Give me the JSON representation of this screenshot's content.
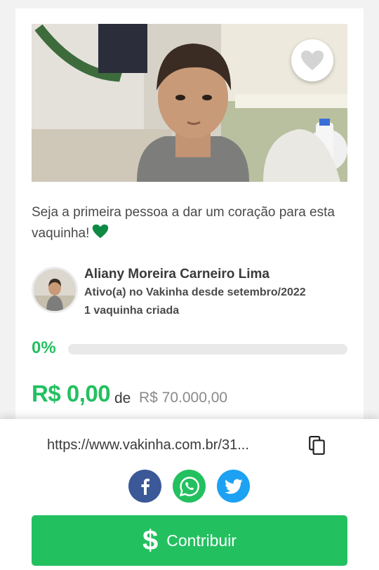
{
  "campaign": {
    "image_alt": "Foto da vaquinha: menino de camiseta cinza",
    "first_heart_text": "Seja a primeira pessoa a dar um coração para esta vaquinha!"
  },
  "creator": {
    "name": "Aliany Moreira Carneiro Lima",
    "since": "Ativo(a) no Vakinha desde setembro/2022",
    "count": "1 vaquinha criada"
  },
  "progress": {
    "percent_label": "0%",
    "fraction": 0
  },
  "amounts": {
    "raised": "R$ 0,00",
    "of": "de",
    "goal": "R$ 70.000,00"
  },
  "share": {
    "link": "https://www.vakinha.com.br/31...",
    "facebook_icon": "facebook-icon",
    "whatsapp_icon": "whatsapp-icon",
    "twitter_icon": "twitter-icon"
  },
  "cta": {
    "symbol": "$",
    "label": "Contribuir"
  },
  "colors": {
    "accent": "#23c060",
    "facebook": "#3b5998",
    "twitter": "#1da1f2"
  }
}
